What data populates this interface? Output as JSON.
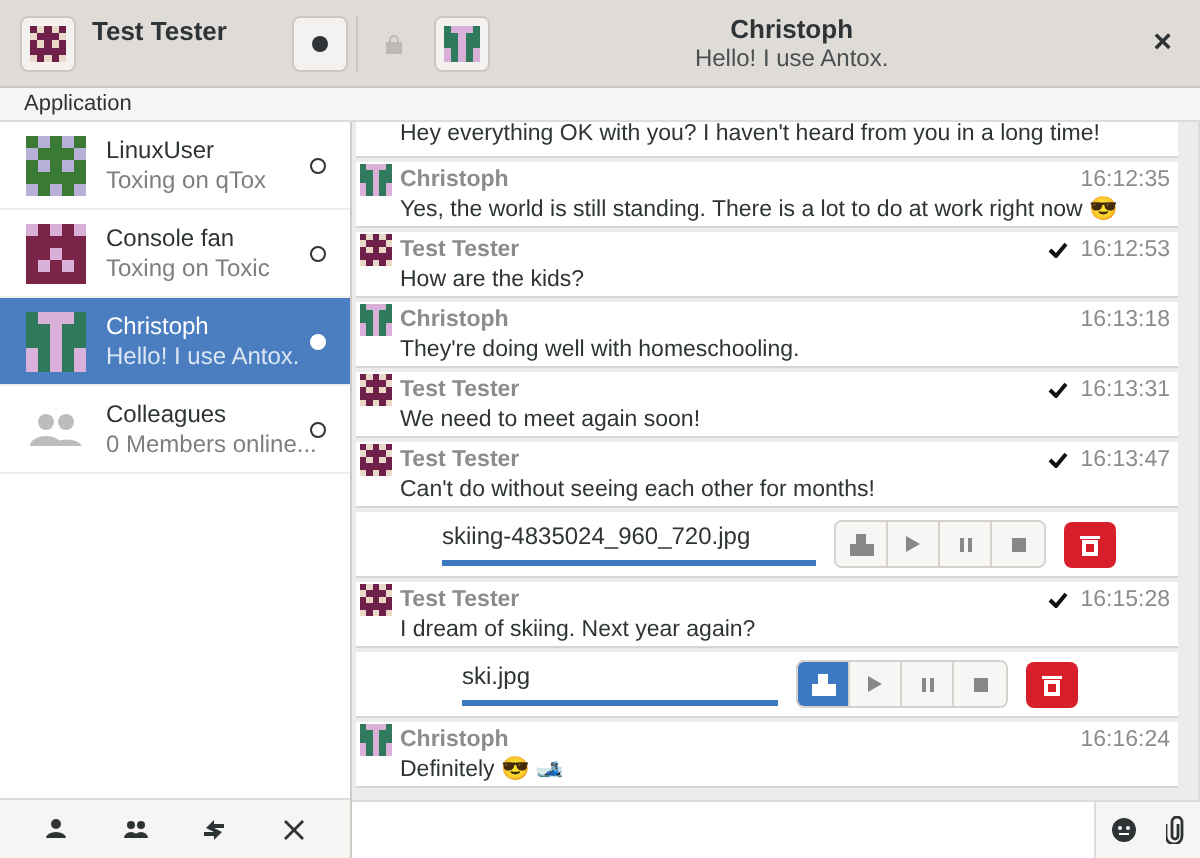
{
  "header": {
    "user_name": "Test Tester",
    "chat_title": "Christoph",
    "chat_subtitle": "Hello! I use Antox.",
    "close": "×"
  },
  "menu": {
    "label": "Application"
  },
  "contacts": [
    {
      "name": "LinuxUser",
      "status": "Toxing on qTox",
      "kind": "person",
      "color": "#3a7a35",
      "selected": false
    },
    {
      "name": "Console fan",
      "status": "Toxing on Toxic",
      "kind": "person",
      "color": "#7a2448",
      "selected": false
    },
    {
      "name": "Christoph",
      "status": "Hello! I use Antox.",
      "kind": "person",
      "color": "#2f7a5c",
      "selected": true
    },
    {
      "name": "Colleagues",
      "status": "0 Members online...",
      "kind": "group",
      "selected": false
    }
  ],
  "messages": [
    {
      "kind": "continuation",
      "text": "Hey everything OK with you? I haven't heard from you in a long time!"
    },
    {
      "kind": "incoming",
      "sender": "Christoph",
      "time": "16:12:35",
      "text": "Yes, the world is still standing. There is a lot to do at work right now 😎",
      "delivered": false
    },
    {
      "kind": "outgoing",
      "sender": "Test Tester",
      "time": "16:12:53",
      "text": "How are the kids?",
      "delivered": true
    },
    {
      "kind": "incoming",
      "sender": "Christoph",
      "time": "16:13:18",
      "text": "They're doing well with homeschooling.",
      "delivered": false
    },
    {
      "kind": "outgoing",
      "sender": "Test Tester",
      "time": "16:13:31",
      "text": "We need to meet again soon!",
      "delivered": true
    },
    {
      "kind": "outgoing",
      "sender": "Test Tester",
      "time": "16:13:47",
      "text": "Can't do without seeing each other for months!",
      "delivered": true
    },
    {
      "kind": "file",
      "name": "skiing-4835024_960_720.jpg",
      "level": 1,
      "open_selected": false
    },
    {
      "kind": "outgoing",
      "sender": "Test Tester",
      "time": "16:15:28",
      "text": "I dream of skiing. Next year again?",
      "delivered": true
    },
    {
      "kind": "file",
      "name": "ski.jpg",
      "level": 1,
      "open_selected": true
    },
    {
      "kind": "incoming",
      "sender": "Christoph",
      "time": "16:16:24",
      "text": "Definitely 😎 🎿",
      "delivered": false
    }
  ]
}
